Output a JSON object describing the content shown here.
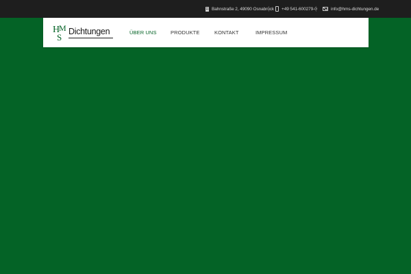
{
  "topbar": {
    "address": "Bahnstraße 2, 49090 Osnabrück",
    "phone": "+49 541-600279-0",
    "email": "info@hms-dichtungen.de",
    "address_icon": "building-icon",
    "phone_icon": "phone-icon",
    "email_icon": "mail-icon"
  },
  "logo": {
    "letters": [
      "H",
      "M",
      "S"
    ],
    "text": "Dichtungen"
  },
  "nav": {
    "items": [
      {
        "label": "ÜBER UNS",
        "active": true
      },
      {
        "label": "PRODUKTE",
        "active": false
      },
      {
        "label": "KONTAKT",
        "active": false
      },
      {
        "label": "IMPRESSUM",
        "active": false
      }
    ]
  },
  "colors": {
    "brand_green": "#046326",
    "topbar_bg": "#1e1e1e",
    "nav_bg": "#ffffff",
    "active_nav": "#046326"
  }
}
